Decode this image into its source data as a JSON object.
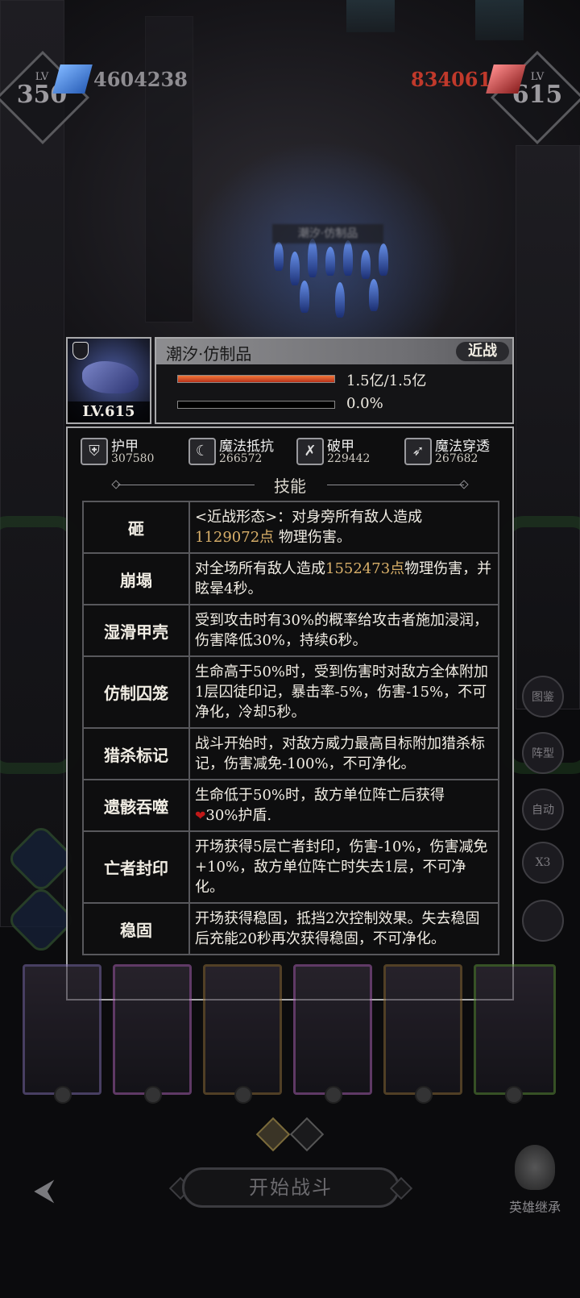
{
  "player": {
    "level_label": "LV",
    "level": "350",
    "power": "4604238"
  },
  "enemy": {
    "level_label": "LV",
    "level": "615",
    "power": "8340617",
    "power_color": "#c0392b"
  },
  "boss_name_blurred": "潮汐·仿制品",
  "unit": {
    "name": "潮汐·仿制品",
    "type_tag": "近战",
    "level": "LV.615",
    "hp_text": "1.5亿/1.5亿",
    "hp_fraction": 1.0,
    "energy_text": "0.0%",
    "energy_fraction": 0.0
  },
  "stats": [
    {
      "icon": "armor-icon",
      "label": "护甲",
      "value": "307580"
    },
    {
      "icon": "magic-resist-icon",
      "label": "魔法抵抗",
      "value": "266572"
    },
    {
      "icon": "armor-break-icon",
      "label": "破甲",
      "value": "229442"
    },
    {
      "icon": "magic-penetration-icon",
      "label": "魔法穿透",
      "value": "267682"
    }
  ],
  "skills_header": "技能",
  "skills": [
    {
      "name": "砸",
      "pre": "<近战形态>：对身旁所有敌人造成",
      "num": "1129072点",
      "post": " 物理伤害。"
    },
    {
      "name": "崩塌",
      "pre": "对全场所有敌人造成",
      "num": "1552473点",
      "post": "物理伤害，并眩晕4秒。"
    },
    {
      "name": "湿滑甲壳",
      "pre": "受到攻击时有30%的概率给攻击者施加浸润，伤害降低30%，持续6秒。",
      "num": "",
      "post": ""
    },
    {
      "name": "仿制囚笼",
      "pre": "生命高于50%时，受到伤害时对敌方全体附加1层囚徒印记，暴击率-5%，伤害-15%，不可净化，冷却5秒。",
      "num": "",
      "post": ""
    },
    {
      "name": "猎杀标记",
      "pre": "战斗开始时，对敌方威力最高目标附加猎杀标记，伤害减免-100%，不可净化。",
      "num": "",
      "post": ""
    },
    {
      "name": "遗骸吞噬",
      "pre": "生命低于50%时，敌方单位阵亡后获得",
      "num": "",
      "post": "30%护盾.",
      "heart": true
    },
    {
      "name": "亡者封印",
      "pre": "开场获得5层亡者封印，伤害-10%，伤害减免+10%，敌方单位阵亡时失去1层，不可净化。",
      "num": "",
      "post": ""
    },
    {
      "name": "稳固",
      "pre": "开场获得稳固，抵挡2次控制效果。失去稳固后充能20秒再次获得稳固，不可净化。",
      "num": "",
      "post": ""
    }
  ],
  "side_buttons": [
    "图鉴",
    "阵型",
    "自动",
    "X3"
  ],
  "bottom": {
    "start_label": "开始战斗",
    "hero_inherit_label": "英雄继承"
  },
  "colors": {
    "hp_bar": "#e0562a",
    "damage_number": "#d9b06a",
    "panel_border": "#a9a9ab"
  }
}
